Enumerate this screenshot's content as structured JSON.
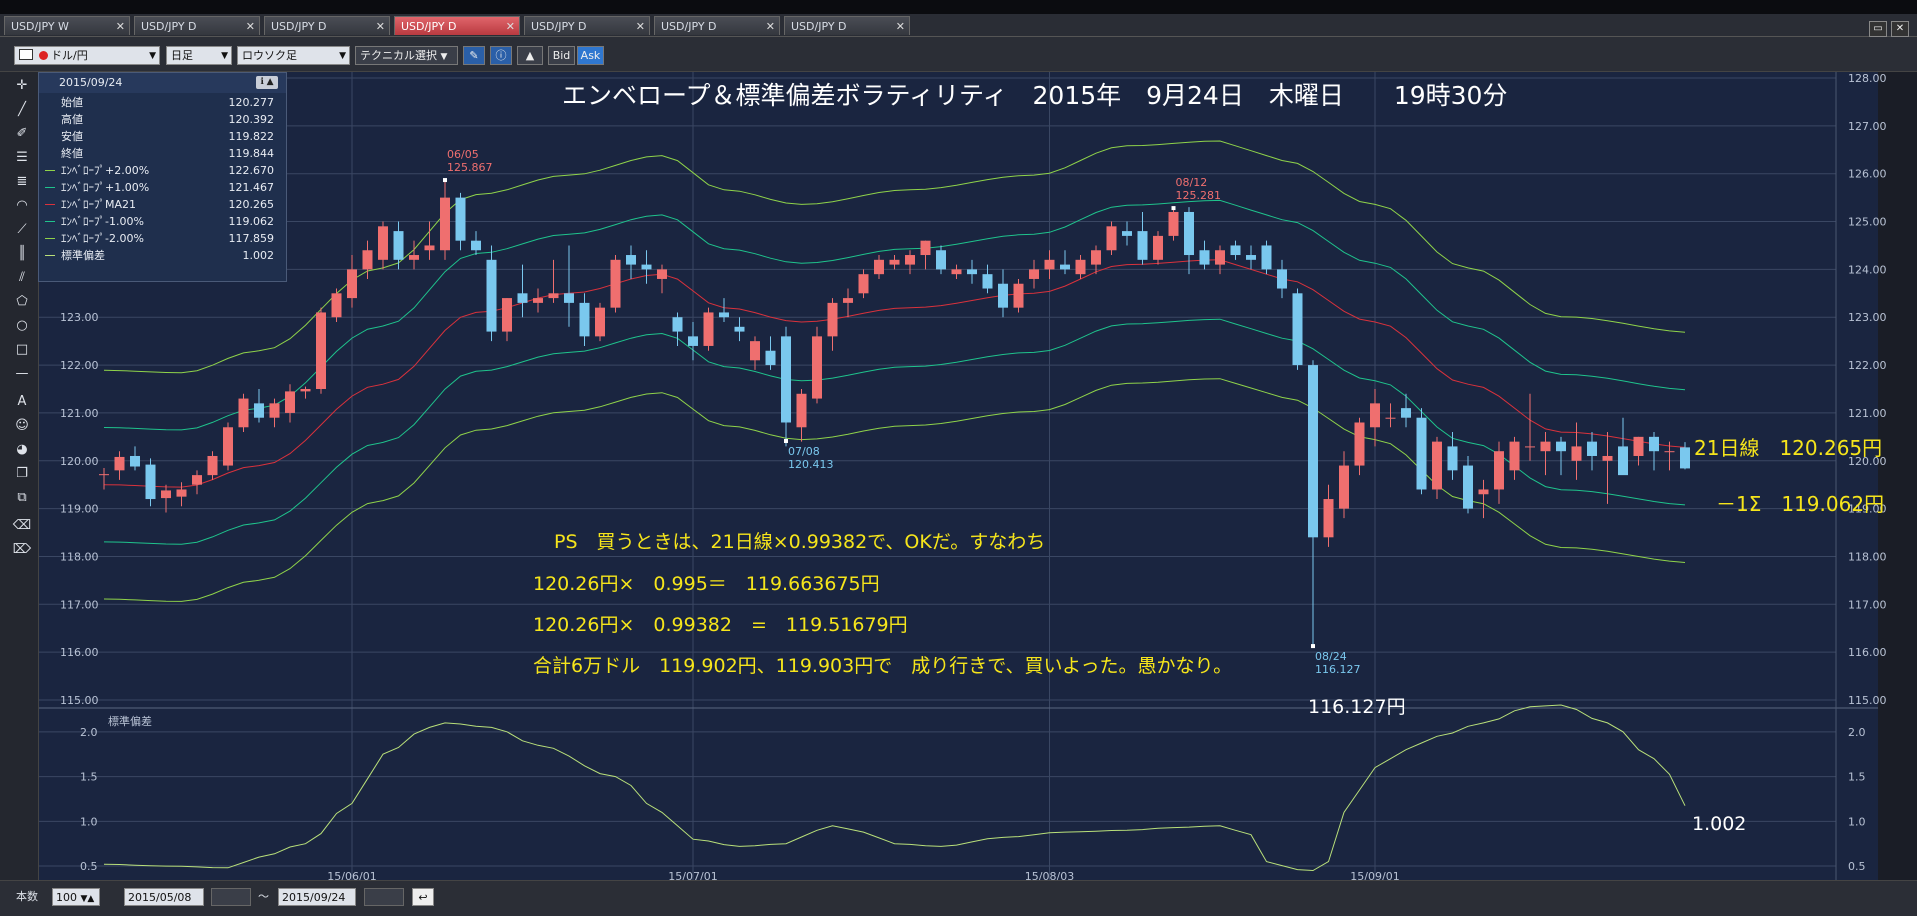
{
  "tabs": [
    {
      "label": "USD/JPY W",
      "active": false
    },
    {
      "label": "USD/JPY D",
      "active": false
    },
    {
      "label": "USD/JPY D",
      "active": false
    },
    {
      "label": "USD/JPY D",
      "active": true
    },
    {
      "label": "USD/JPY D",
      "active": false
    },
    {
      "label": "USD/JPY D",
      "active": false
    },
    {
      "label": "USD/JPY D",
      "active": false
    }
  ],
  "toolbar": {
    "pair": "ドル/円",
    "period": "日足",
    "chart_style": "ロウソク足",
    "tech_select": "テクニカル選択",
    "bid": "Bid",
    "ask": "Ask"
  },
  "info": {
    "date": "2015/09/24",
    "rows": [
      {
        "label": "始値",
        "value": "120.277",
        "color": ""
      },
      {
        "label": "高値",
        "value": "120.392",
        "color": ""
      },
      {
        "label": "安値",
        "value": "119.822",
        "color": ""
      },
      {
        "label": "終値",
        "value": "119.844",
        "color": ""
      },
      {
        "label": "ｴﾝﾍﾞﾛｰﾌﾟ+2.00%",
        "value": "122.670",
        "color": "#8fd34a"
      },
      {
        "label": "ｴﾝﾍﾞﾛｰﾌﾟ+1.00%",
        "value": "121.467",
        "color": "#1fc38c"
      },
      {
        "label": "ｴﾝﾍﾞﾛｰﾌﾟMA21",
        "value": "120.265",
        "color": "#d9323c"
      },
      {
        "label": "ｴﾝﾍﾞﾛｰﾌﾟ-1.00%",
        "value": "119.062",
        "color": "#1fc38c"
      },
      {
        "label": "ｴﾝﾍﾞﾛｰﾌﾟ-2.00%",
        "value": "117.859",
        "color": "#8fd34a"
      },
      {
        "label": "標準偏差",
        "value": "1.002",
        "color": "#b9e07a"
      }
    ]
  },
  "bottom": {
    "count_label": "本数",
    "count": "100",
    "from": "2015/05/08",
    "tilde": "～",
    "to": "2015/09/24"
  },
  "annotations": {
    "title": "エンベロープ＆標準偏差ボラティリティ　2015年　9月24日　木曜日　　19時30分",
    "line1": "PS　買うときは、21日線×0.99382で、OKだ。すなわち",
    "line2": "120.26円×　0.995＝　119.663675円",
    "line3": "120.26円×　0.99382　=　119.51679円",
    "line4": "合計6万ドル　119.902円、119.903円で　成り行きで、買いよった。愚かなり。",
    "ma21_label": "21日線　120.265円",
    "minus_sigma_label": "－1Σ　119.062円",
    "low_label": "116.127円",
    "std_label": "1.002",
    "ann_0605_date": "06/05",
    "ann_0605_val": "125.867",
    "ann_0708_date": "07/08",
    "ann_0708_val": "120.413",
    "ann_0812_date": "08/12",
    "ann_0812_val": "125.281",
    "ann_0824_date": "08/24",
    "ann_0824_val": "116.127"
  },
  "colors": {
    "up": "#ef6f6f",
    "down": "#7ac8ee",
    "env2": "#8fd34a",
    "env1": "#1fc38c",
    "ma": "#d9323c",
    "std": "#b9e07a",
    "annotation_text": "#f6e51b",
    "grid": "#3a4763",
    "panel_bg": "#1a2540"
  },
  "chart_data": [
    {
      "type": "candlestick",
      "title": "エンベロープ＆標準偏差ボラティリティ　2015年　9月24日　木曜日　　19時30分",
      "ylim": [
        115.0,
        128.0
      ],
      "y_ticks": [
        "115.00",
        "116.00",
        "117.00",
        "118.00",
        "119.00",
        "120.00",
        "121.00",
        "122.00",
        "123.00",
        "124.00",
        "125.00",
        "126.00",
        "127.00",
        "128.00"
      ],
      "x_ticks": [
        {
          "label": "15/06/01",
          "index": 16
        },
        {
          "label": "15/07/01",
          "index": 38
        },
        {
          "label": "15/08/03",
          "index": 61
        },
        {
          "label": "15/09/01",
          "index": 82
        }
      ],
      "ohlc": [
        [
          119.7,
          119.85,
          119.4,
          119.72
        ],
        [
          119.8,
          120.2,
          119.6,
          120.08
        ],
        [
          120.1,
          120.3,
          119.8,
          119.88
        ],
        [
          119.92,
          120.05,
          119.05,
          119.2
        ],
        [
          119.22,
          119.5,
          118.92,
          119.38
        ],
        [
          119.25,
          119.55,
          119.05,
          119.4
        ],
        [
          119.5,
          119.8,
          119.3,
          119.7
        ],
        [
          119.7,
          120.2,
          119.6,
          120.1
        ],
        [
          119.9,
          120.8,
          119.8,
          120.7
        ],
        [
          120.7,
          121.4,
          120.6,
          121.3
        ],
        [
          121.2,
          121.5,
          120.8,
          120.9
        ],
        [
          120.9,
          121.3,
          120.7,
          121.2
        ],
        [
          121.0,
          121.6,
          120.8,
          121.45
        ],
        [
          121.45,
          121.55,
          121.3,
          121.5
        ],
        [
          121.5,
          123.2,
          121.4,
          123.1
        ],
        [
          123.0,
          123.6,
          122.9,
          123.5
        ],
        [
          123.4,
          124.3,
          123.2,
          124.0
        ],
        [
          124.0,
          124.6,
          123.8,
          124.4
        ],
        [
          124.2,
          125.0,
          124.0,
          124.9
        ],
        [
          124.8,
          125.0,
          124.0,
          124.2
        ],
        [
          124.2,
          124.6,
          124.0,
          124.3
        ],
        [
          124.4,
          125.0,
          124.2,
          124.5
        ],
        [
          124.4,
          125.9,
          124.2,
          125.5
        ],
        [
          125.5,
          125.6,
          124.4,
          124.6
        ],
        [
          124.6,
          124.8,
          124.3,
          124.4
        ],
        [
          124.2,
          124.5,
          122.5,
          122.7
        ],
        [
          122.7,
          123.4,
          122.5,
          123.4
        ],
        [
          123.5,
          124.1,
          123.0,
          123.3
        ],
        [
          123.3,
          123.6,
          123.1,
          123.4
        ],
        [
          123.4,
          124.2,
          123.3,
          123.5
        ],
        [
          123.5,
          124.5,
          122.8,
          123.3
        ],
        [
          123.3,
          123.5,
          122.4,
          122.6
        ],
        [
          122.6,
          123.3,
          122.5,
          123.2
        ],
        [
          123.2,
          124.3,
          123.1,
          124.2
        ],
        [
          124.3,
          124.5,
          123.8,
          124.1
        ],
        [
          124.1,
          124.4,
          123.7,
          124.0
        ],
        [
          123.8,
          124.1,
          123.5,
          124.0
        ],
        [
          123.0,
          123.1,
          122.4,
          122.7
        ],
        [
          122.6,
          122.9,
          122.1,
          122.4
        ],
        [
          122.4,
          123.2,
          122.3,
          123.1
        ],
        [
          123.1,
          123.4,
          122.9,
          123.0
        ],
        [
          122.8,
          123.0,
          122.5,
          122.7
        ],
        [
          122.1,
          122.6,
          121.9,
          122.5
        ],
        [
          122.3,
          122.6,
          121.9,
          122.0
        ],
        [
          122.6,
          122.8,
          120.3,
          120.8
        ],
        [
          120.7,
          121.5,
          120.4,
          121.4
        ],
        [
          121.3,
          122.8,
          121.2,
          122.6
        ],
        [
          122.6,
          123.4,
          122.3,
          123.3
        ],
        [
          123.3,
          123.6,
          123.0,
          123.4
        ],
        [
          123.5,
          124.0,
          123.4,
          123.9
        ],
        [
          123.9,
          124.3,
          123.8,
          124.2
        ],
        [
          124.1,
          124.3,
          124.0,
          124.2
        ],
        [
          124.1,
          124.4,
          123.9,
          124.3
        ],
        [
          124.3,
          124.6,
          124.0,
          124.6
        ],
        [
          124.4,
          124.5,
          123.9,
          124.0
        ],
        [
          123.9,
          124.1,
          123.8,
          124.0
        ],
        [
          124.0,
          124.2,
          123.7,
          123.9
        ],
        [
          123.9,
          124.1,
          123.5,
          123.6
        ],
        [
          123.7,
          124.0,
          123.0,
          123.2
        ],
        [
          123.2,
          123.8,
          123.1,
          123.7
        ],
        [
          123.8,
          124.2,
          123.6,
          124.0
        ],
        [
          124.0,
          124.4,
          123.8,
          124.2
        ],
        [
          124.1,
          124.4,
          123.9,
          124.0
        ],
        [
          123.9,
          124.3,
          123.8,
          124.2
        ],
        [
          124.1,
          124.5,
          123.9,
          124.4
        ],
        [
          124.4,
          125.0,
          124.3,
          124.9
        ],
        [
          124.8,
          125.0,
          124.5,
          124.7
        ],
        [
          124.8,
          125.2,
          124.1,
          124.2
        ],
        [
          124.2,
          124.8,
          124.1,
          124.7
        ],
        [
          124.7,
          125.3,
          124.6,
          125.2
        ],
        [
          125.2,
          125.3,
          123.9,
          124.3
        ],
        [
          124.4,
          124.6,
          124.0,
          124.1
        ],
        [
          124.1,
          124.5,
          123.9,
          124.4
        ],
        [
          124.5,
          124.6,
          124.2,
          124.3
        ],
        [
          124.3,
          124.5,
          124.0,
          124.2
        ],
        [
          124.5,
          124.6,
          123.9,
          124.0
        ],
        [
          124.0,
          124.2,
          123.4,
          123.6
        ],
        [
          123.5,
          123.6,
          121.9,
          122.0
        ],
        [
          122.0,
          122.1,
          116.13,
          118.4
        ],
        [
          118.4,
          119.5,
          118.2,
          119.2
        ],
        [
          119.0,
          120.2,
          118.8,
          119.9
        ],
        [
          119.9,
          120.9,
          119.7,
          120.8
        ],
        [
          120.7,
          121.5,
          120.3,
          121.2
        ],
        [
          120.9,
          121.2,
          120.7,
          120.9
        ],
        [
          121.1,
          121.4,
          120.7,
          120.9
        ],
        [
          120.9,
          121.1,
          119.3,
          119.4
        ],
        [
          119.4,
          120.5,
          119.2,
          120.4
        ],
        [
          120.3,
          120.6,
          119.6,
          119.8
        ],
        [
          119.9,
          120.1,
          118.9,
          119.0
        ],
        [
          119.3,
          119.6,
          118.8,
          119.4
        ],
        [
          119.4,
          120.4,
          119.1,
          120.2
        ],
        [
          119.8,
          120.5,
          119.6,
          120.4
        ],
        [
          120.3,
          121.4,
          120.0,
          120.3
        ],
        [
          120.2,
          120.6,
          119.7,
          120.4
        ],
        [
          120.4,
          120.5,
          119.7,
          120.2
        ],
        [
          120.0,
          120.8,
          119.6,
          120.3
        ],
        [
          120.4,
          120.6,
          119.8,
          120.1
        ],
        [
          120.0,
          120.6,
          119.1,
          120.1
        ],
        [
          120.3,
          120.9,
          119.8,
          119.7
        ],
        [
          120.1,
          120.5,
          119.9,
          120.5
        ],
        [
          120.5,
          120.6,
          119.8,
          120.2
        ],
        [
          120.2,
          120.4,
          119.8,
          120.2
        ],
        [
          120.28,
          120.39,
          119.82,
          119.84
        ]
      ],
      "ma21_anchors": [
        [
          0,
          119.5
        ],
        [
          5,
          119.45
        ],
        [
          10,
          119.9
        ],
        [
          18,
          121.6
        ],
        [
          24,
          123.1
        ],
        [
          30,
          123.5
        ],
        [
          36,
          123.9
        ],
        [
          40,
          123.2
        ],
        [
          45,
          122.9
        ],
        [
          52,
          123.2
        ],
        [
          60,
          123.5
        ],
        [
          66,
          124.1
        ],
        [
          72,
          124.2
        ],
        [
          74,
          124.0
        ],
        [
          76,
          123.8
        ],
        [
          82,
          122.9
        ],
        [
          88,
          121.6
        ],
        [
          94,
          120.6
        ],
        [
          103,
          120.27
        ]
      ],
      "envelopes": [
        {
          "name": "ｴﾝﾍﾞﾛｰﾌﾟ+2.00%",
          "pct": 2,
          "color": "#8fd34a"
        },
        {
          "name": "ｴﾝﾍﾞﾛｰﾌﾟ+1.00%",
          "pct": 1,
          "color": "#1fc38c"
        },
        {
          "name": "ｴﾝﾍﾞﾛｰﾌﾟMA21",
          "pct": 0,
          "color": "#d9323c"
        },
        {
          "name": "ｴﾝﾍﾞﾛｰﾌﾟ-1.00%",
          "pct": -1,
          "color": "#1fc38c"
        },
        {
          "name": "ｴﾝﾍﾞﾛｰﾌﾟ-2.00%",
          "pct": -2,
          "color": "#8fd34a"
        }
      ],
      "annotated_points": [
        {
          "index": 22,
          "date": "06/05",
          "value": 125.867,
          "pos": "top"
        },
        {
          "index": 44,
          "date": "07/08",
          "value": 120.413,
          "pos": "bottom"
        },
        {
          "index": 69,
          "date": "08/12",
          "value": 125.281,
          "pos": "top"
        },
        {
          "index": 78,
          "date": "08/24",
          "value": 116.127,
          "pos": "bottom"
        }
      ]
    },
    {
      "type": "line",
      "title": "標準偏差",
      "ylim": [
        0.4,
        2.3
      ],
      "y_ticks": [
        "0.5",
        "1.0",
        "1.5",
        "2.0"
      ],
      "anchors": [
        [
          0,
          0.52
        ],
        [
          4,
          0.5
        ],
        [
          8,
          0.48
        ],
        [
          10,
          0.6
        ],
        [
          13,
          0.75
        ],
        [
          16,
          1.2
        ],
        [
          18,
          1.75
        ],
        [
          21,
          2.05
        ],
        [
          22,
          2.1
        ],
        [
          25,
          2.05
        ],
        [
          28,
          1.85
        ],
        [
          33,
          1.5
        ],
        [
          36,
          1.1
        ],
        [
          38,
          0.8
        ],
        [
          41,
          0.72
        ],
        [
          44,
          0.75
        ],
        [
          46,
          0.9
        ],
        [
          47,
          0.95
        ],
        [
          49,
          0.88
        ],
        [
          51,
          0.75
        ],
        [
          54,
          0.72
        ],
        [
          58,
          0.82
        ],
        [
          62,
          0.88
        ],
        [
          66,
          0.9
        ],
        [
          69,
          0.93
        ],
        [
          72,
          0.95
        ],
        [
          74,
          0.85
        ],
        [
          75,
          0.55
        ],
        [
          77,
          0.46
        ],
        [
          78,
          0.45
        ],
        [
          79,
          0.55
        ],
        [
          80,
          1.1
        ],
        [
          82,
          1.6
        ],
        [
          84,
          1.8
        ],
        [
          86,
          1.95
        ],
        [
          89,
          2.1
        ],
        [
          92,
          2.28
        ],
        [
          94,
          2.3
        ],
        [
          97,
          2.1
        ],
        [
          100,
          1.7
        ],
        [
          103,
          1.0
        ]
      ]
    }
  ]
}
